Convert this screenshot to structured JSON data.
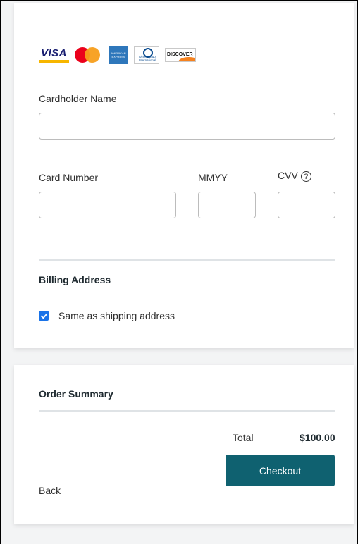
{
  "payment": {
    "card_brands": [
      "VISA",
      "Mastercard",
      "American Express",
      "Diners Club International",
      "DISCOVER"
    ],
    "visa_text": "VISA",
    "amex_text": "AMERICAN EXPRESS",
    "diners_text": "Diners Club International",
    "discover_text": "DISCOVER",
    "cardholder_label": "Cardholder Name",
    "cardholder_value": "",
    "card_number_label": "Card Number",
    "card_number_value": "",
    "mmyy_label": "MMYY",
    "mmyy_value": "",
    "cvv_label": "CVV",
    "cvv_value": "",
    "cvv_help_glyph": "?"
  },
  "billing": {
    "title": "Billing Address",
    "same_as_shipping_label": "Same as shipping address",
    "same_as_shipping_checked": true
  },
  "summary": {
    "title": "Order Summary",
    "total_label": "Total",
    "total_value": "$100.00",
    "back_label": "Back",
    "checkout_label": "Checkout"
  },
  "colors": {
    "checkout_button": "#0f6170",
    "checkbox": "#1a73e8",
    "page_background": "#f3f4f5"
  }
}
